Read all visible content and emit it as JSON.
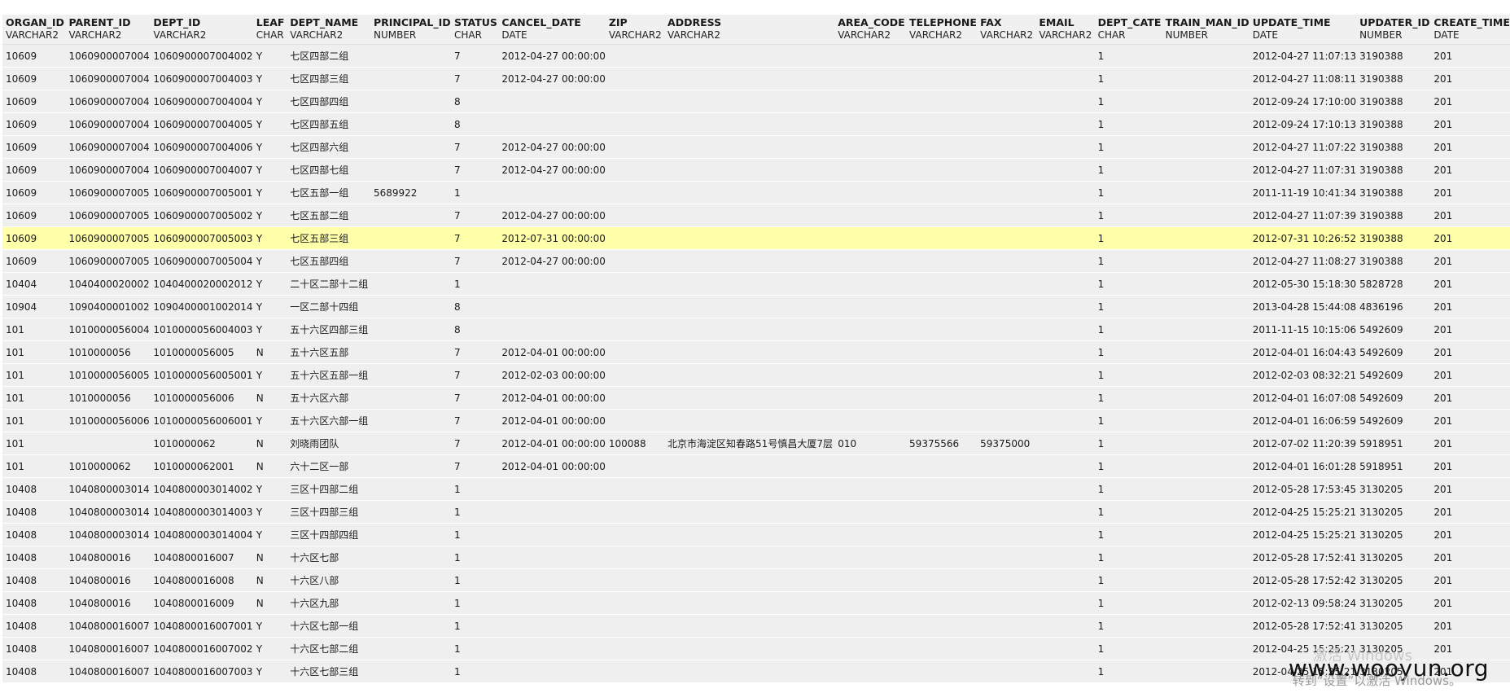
{
  "columns": [
    {
      "name": "ORGAN_ID",
      "type": "VARCHAR2"
    },
    {
      "name": "PARENT_ID",
      "type": "VARCHAR2"
    },
    {
      "name": "DEPT_ID",
      "type": "VARCHAR2"
    },
    {
      "name": "LEAF",
      "type": "CHAR"
    },
    {
      "name": "DEPT_NAME",
      "type": "VARCHAR2"
    },
    {
      "name": "PRINCIPAL_ID",
      "type": "NUMBER"
    },
    {
      "name": "STATUS",
      "type": "CHAR"
    },
    {
      "name": "CANCEL_DATE",
      "type": "DATE"
    },
    {
      "name": "ZIP",
      "type": "VARCHAR2"
    },
    {
      "name": "ADDRESS",
      "type": "VARCHAR2"
    },
    {
      "name": "AREA_CODE",
      "type": "VARCHAR2"
    },
    {
      "name": "TELEPHONE",
      "type": "VARCHAR2"
    },
    {
      "name": "FAX",
      "type": "VARCHAR2"
    },
    {
      "name": "EMAIL",
      "type": "VARCHAR2"
    },
    {
      "name": "DEPT_CATE",
      "type": "CHAR"
    },
    {
      "name": "TRAIN_MAN_ID",
      "type": "NUMBER"
    },
    {
      "name": "UPDATE_TIME",
      "type": "DATE"
    },
    {
      "name": "UPDATER_ID",
      "type": "NUMBER"
    },
    {
      "name": "CREATE_TIME",
      "type": "DATE"
    }
  ],
  "rows": [
    [
      "10609",
      "1060900007004",
      "1060900007004002",
      "Y",
      "七区四部二组",
      "",
      "7",
      "2012-04-27 00:00:00",
      "",
      "",
      "",
      "",
      "",
      "",
      "1",
      "",
      "2012-04-27 11:07:13",
      "3190388",
      "201"
    ],
    [
      "10609",
      "1060900007004",
      "1060900007004003",
      "Y",
      "七区四部三组",
      "",
      "7",
      "2012-04-27 00:00:00",
      "",
      "",
      "",
      "",
      "",
      "",
      "1",
      "",
      "2012-04-27 11:08:11",
      "3190388",
      "201"
    ],
    [
      "10609",
      "1060900007004",
      "1060900007004004",
      "Y",
      "七区四部四组",
      "",
      "8",
      "",
      "",
      "",
      "",
      "",
      "",
      "",
      "1",
      "",
      "2012-09-24 17:10:00",
      "3190388",
      "201"
    ],
    [
      "10609",
      "1060900007004",
      "1060900007004005",
      "Y",
      "七区四部五组",
      "",
      "8",
      "",
      "",
      "",
      "",
      "",
      "",
      "",
      "1",
      "",
      "2012-09-24 17:10:13",
      "3190388",
      "201"
    ],
    [
      "10609",
      "1060900007004",
      "1060900007004006",
      "Y",
      "七区四部六组",
      "",
      "7",
      "2012-04-27 00:00:00",
      "",
      "",
      "",
      "",
      "",
      "",
      "1",
      "",
      "2012-04-27 11:07:22",
      "3190388",
      "201"
    ],
    [
      "10609",
      "1060900007004",
      "1060900007004007",
      "Y",
      "七区四部七组",
      "",
      "7",
      "2012-04-27 00:00:00",
      "",
      "",
      "",
      "",
      "",
      "",
      "1",
      "",
      "2012-04-27 11:07:31",
      "3190388",
      "201"
    ],
    [
      "10609",
      "1060900007005",
      "1060900007005001",
      "Y",
      "七区五部一组",
      "5689922",
      "1",
      "",
      "",
      "",
      "",
      "",
      "",
      "",
      "1",
      "",
      "2011-11-19 10:41:34",
      "3190388",
      "201"
    ],
    [
      "10609",
      "1060900007005",
      "1060900007005002",
      "Y",
      "七区五部二组",
      "",
      "7",
      "2012-04-27 00:00:00",
      "",
      "",
      "",
      "",
      "",
      "",
      "1",
      "",
      "2012-04-27 11:07:39",
      "3190388",
      "201"
    ],
    [
      "10609",
      "1060900007005",
      "1060900007005003",
      "Y",
      "七区五部三组",
      "",
      "7",
      "2012-07-31 00:00:00",
      "",
      "",
      "",
      "",
      "",
      "",
      "1",
      "",
      "2012-07-31 10:26:52",
      "3190388",
      "201"
    ],
    [
      "10609",
      "1060900007005",
      "1060900007005004",
      "Y",
      "七区五部四组",
      "",
      "7",
      "2012-04-27 00:00:00",
      "",
      "",
      "",
      "",
      "",
      "",
      "1",
      "",
      "2012-04-27 11:08:27",
      "3190388",
      "201"
    ],
    [
      "10404",
      "1040400020002",
      "1040400020002012",
      "Y",
      "二十区二部十二组",
      "",
      "1",
      "",
      "",
      "",
      "",
      "",
      "",
      "",
      "1",
      "",
      "2012-05-30 15:18:30",
      "5828728",
      "201"
    ],
    [
      "10904",
      "1090400001002",
      "1090400001002014",
      "Y",
      "一区二部十四组",
      "",
      "8",
      "",
      "",
      "",
      "",
      "",
      "",
      "",
      "1",
      "",
      "2013-04-28 15:44:08",
      "4836196",
      "201"
    ],
    [
      "101",
      "1010000056004",
      "1010000056004003",
      "Y",
      "五十六区四部三组",
      "",
      "8",
      "",
      "",
      "",
      "",
      "",
      "",
      "",
      "1",
      "",
      "2011-11-15 10:15:06",
      "5492609",
      "201"
    ],
    [
      "101",
      "1010000056",
      "1010000056005",
      "N",
      "五十六区五部",
      "",
      "7",
      "2012-04-01 00:00:00",
      "",
      "",
      "",
      "",
      "",
      "",
      "1",
      "",
      "2012-04-01 16:04:43",
      "5492609",
      "201"
    ],
    [
      "101",
      "1010000056005",
      "1010000056005001",
      "Y",
      "五十六区五部一组",
      "",
      "7",
      "2012-02-03 00:00:00",
      "",
      "",
      "",
      "",
      "",
      "",
      "1",
      "",
      "2012-02-03 08:32:21",
      "5492609",
      "201"
    ],
    [
      "101",
      "1010000056",
      "1010000056006",
      "N",
      "五十六区六部",
      "",
      "7",
      "2012-04-01 00:00:00",
      "",
      "",
      "",
      "",
      "",
      "",
      "1",
      "",
      "2012-04-01 16:07:08",
      "5492609",
      "201"
    ],
    [
      "101",
      "1010000056006",
      "1010000056006001",
      "Y",
      "五十六区六部一组",
      "",
      "7",
      "2012-04-01 00:00:00",
      "",
      "",
      "",
      "",
      "",
      "",
      "1",
      "",
      "2012-04-01 16:06:59",
      "5492609",
      "201"
    ],
    [
      "101",
      "",
      "1010000062",
      "N",
      "刘晓雨团队",
      "",
      "7",
      "2012-04-01 00:00:00",
      "100088",
      "北京市海淀区知春路51号慎昌大厦7层",
      "010",
      "59375566",
      "59375000",
      "",
      "1",
      "",
      "2012-07-02 11:20:39",
      "5918951",
      "201"
    ],
    [
      "101",
      "1010000062",
      "1010000062001",
      "N",
      "六十二区一部",
      "",
      "7",
      "2012-04-01 00:00:00",
      "",
      "",
      "",
      "",
      "",
      "",
      "1",
      "",
      "2012-04-01 16:01:28",
      "5918951",
      "201"
    ],
    [
      "10408",
      "1040800003014",
      "1040800003014002",
      "Y",
      "三区十四部二组",
      "",
      "1",
      "",
      "",
      "",
      "",
      "",
      "",
      "",
      "1",
      "",
      "2012-05-28 17:53:45",
      "3130205",
      "201"
    ],
    [
      "10408",
      "1040800003014",
      "1040800003014003",
      "Y",
      "三区十四部三组",
      "",
      "1",
      "",
      "",
      "",
      "",
      "",
      "",
      "",
      "1",
      "",
      "2012-04-25 15:25:21",
      "3130205",
      "201"
    ],
    [
      "10408",
      "1040800003014",
      "1040800003014004",
      "Y",
      "三区十四部四组",
      "",
      "1",
      "",
      "",
      "",
      "",
      "",
      "",
      "",
      "1",
      "",
      "2012-04-25 15:25:21",
      "3130205",
      "201"
    ],
    [
      "10408",
      "1040800016",
      "1040800016007",
      "N",
      "十六区七部",
      "",
      "1",
      "",
      "",
      "",
      "",
      "",
      "",
      "",
      "1",
      "",
      "2012-05-28 17:52:41",
      "3130205",
      "201"
    ],
    [
      "10408",
      "1040800016",
      "1040800016008",
      "N",
      "十六区八部",
      "",
      "1",
      "",
      "",
      "",
      "",
      "",
      "",
      "",
      "1",
      "",
      "2012-05-28 17:52:42",
      "3130205",
      "201"
    ],
    [
      "10408",
      "1040800016",
      "1040800016009",
      "N",
      "十六区九部",
      "",
      "1",
      "",
      "",
      "",
      "",
      "",
      "",
      "",
      "1",
      "",
      "2012-02-13 09:58:24",
      "3130205",
      "201"
    ],
    [
      "10408",
      "1040800016007",
      "1040800016007001",
      "Y",
      "十六区七部一组",
      "",
      "1",
      "",
      "",
      "",
      "",
      "",
      "",
      "",
      "1",
      "",
      "2012-05-28 17:52:41",
      "3130205",
      "201"
    ],
    [
      "10408",
      "1040800016007",
      "1040800016007002",
      "Y",
      "十六区七部二组",
      "",
      "1",
      "",
      "",
      "",
      "",
      "",
      "",
      "",
      "1",
      "",
      "2012-04-25 15:25:21",
      "3130205",
      "201"
    ],
    [
      "10408",
      "1040800016007",
      "1040800016007003",
      "Y",
      "十六区七部三组",
      "",
      "1",
      "",
      "",
      "",
      "",
      "",
      "",
      "",
      "1",
      "",
      "2012-04-25 15:25:21",
      "3130205",
      "201"
    ]
  ],
  "selected_row": 8,
  "colors": {
    "selected_row_bg": "#ffffaa",
    "cell_bg": "#efefef",
    "header_bg": "#f0f0f0"
  },
  "watermark": {
    "site": "www.wooyun.org",
    "ghost": "激活 Windows",
    "activate": "转到“设置”以激活 Windows。"
  }
}
